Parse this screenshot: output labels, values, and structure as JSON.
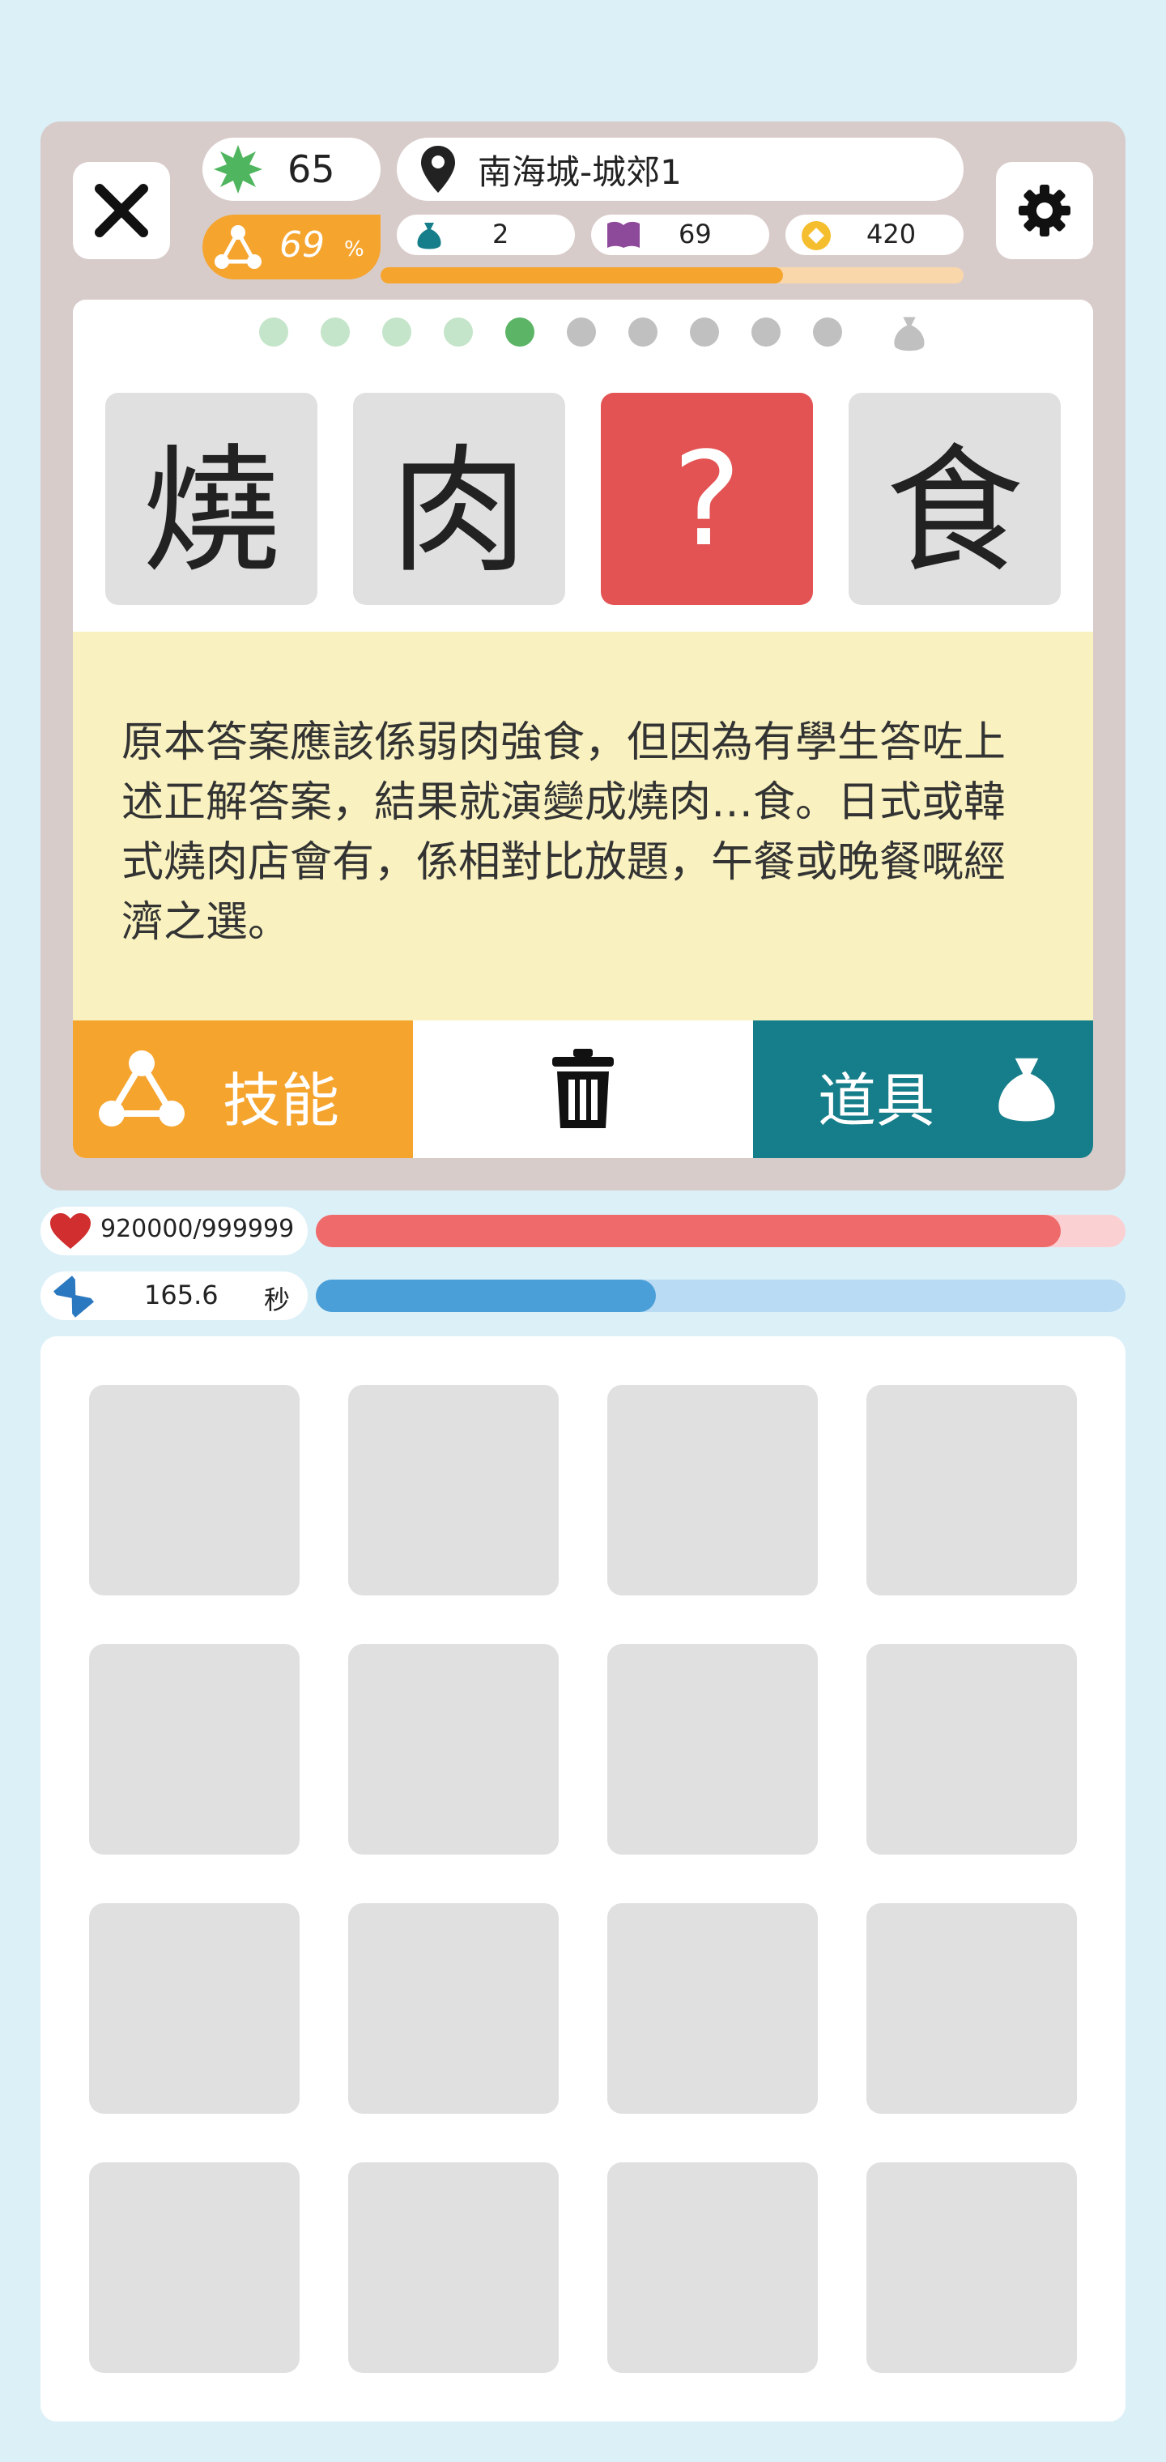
{
  "header": {
    "level": "65",
    "location": "南海城-城郊1",
    "skill_percent": "69",
    "skill_percent_unit": "%",
    "bags": "2",
    "books": "69",
    "coins": "420",
    "progress_fraction": 0.69
  },
  "question": {
    "progress": [
      "done",
      "done",
      "done",
      "done",
      "current",
      "todo",
      "todo",
      "todo",
      "todo",
      "todo"
    ],
    "tiles": [
      "燒",
      "肉",
      "?",
      "食"
    ],
    "description": "原本答案應該係弱肉強食，但因為有學生答咗上述正解答案，結果就演變成燒肉…食。日式或韓式燒肉店會有，係相對比放題，午餐或晚餐嘅經濟之選。"
  },
  "actions": {
    "skill_label": "技能",
    "item_label": "道具"
  },
  "stats": {
    "hp_current": "920000",
    "hp_max": "999999",
    "hp_fraction": 0.92,
    "time_value": "165.6",
    "time_unit": "秒",
    "time_fraction": 0.42
  },
  "colors": {
    "accent_orange": "#f5a42e",
    "teal": "#167e8a",
    "question_red": "#e35353",
    "hp_red": "#ef6b6b",
    "time_blue": "#4a9fd8"
  },
  "icons": [
    "close-icon",
    "gear-icon",
    "star-icon",
    "location-pin-icon",
    "triangle-nodes-icon",
    "bag-icon",
    "book-icon",
    "coin-icon",
    "trash-icon",
    "heart-icon",
    "hourglass-icon"
  ]
}
